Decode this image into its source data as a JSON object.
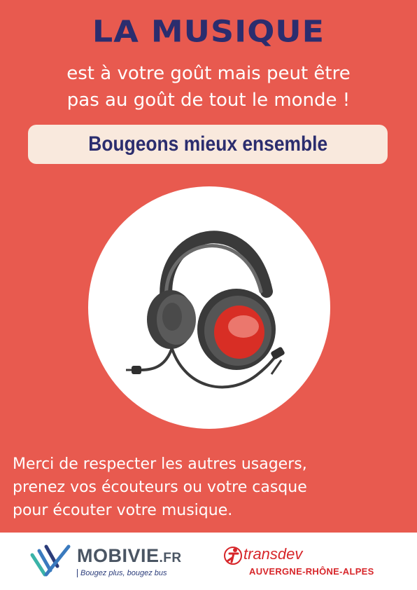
{
  "poster": {
    "title": "LA MUSIQUE",
    "subtitle_line1": "est à votre goût mais peut être",
    "subtitle_line2": "pas au goût de tout le monde !",
    "banner": "Bougeons mieux ensemble",
    "illustration_icon": "headphones-icon",
    "message_line1": "Merci de respecter les autres usagers,",
    "message_line2": "prenez vos écouteurs ou votre casque",
    "message_line3": "pour écouter votre musique."
  },
  "footer": {
    "mobivie_name": "MOBIVIE",
    "mobivie_ext": ".FR",
    "mobivie_tagline": "Bougez plus, bougez bus",
    "transdev_name": "transdev",
    "transdev_region": "AUVERGNE-RHÔNE-ALPES"
  },
  "colors": {
    "background": "#E85A4F",
    "title": "#2B2D6E",
    "banner_bg": "#F9E9DD",
    "transdev_red": "#D7262A"
  }
}
